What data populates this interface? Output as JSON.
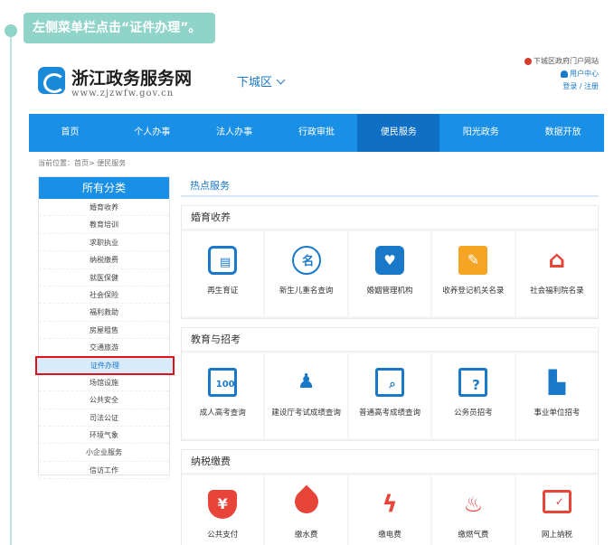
{
  "instruction": "左侧菜单栏点击“证件办理”。",
  "site": {
    "title": "浙江政务服务网",
    "url": "www.zjzwfw.gov.cn",
    "region": "下城区",
    "portal_link": "下城区政府门户网站",
    "user_center": "用户中心",
    "login": "登录",
    "register": "注册"
  },
  "nav": [
    "首页",
    "个人办事",
    "法人办事",
    "行政审批",
    "便民服务",
    "阳光政务",
    "数据开放"
  ],
  "nav_active_index": 4,
  "breadcrumb": "当前位置：首页> 便民服务",
  "sidebar": {
    "title": "所有分类",
    "items": [
      "婚育收养",
      "教育培训",
      "求职执业",
      "纳税缴费",
      "就医保健",
      "社会保险",
      "福利救助",
      "房屋租售",
      "交通旅游",
      "证件办理",
      "场馆设施",
      "公共安全",
      "司法公证",
      "环境气象",
      "小企业服务",
      "信访工作"
    ],
    "selected_index": 9
  },
  "hot_title": "热点服务",
  "sections": [
    {
      "title": "婚育收养",
      "tiles": [
        {
          "label": "再生育证",
          "icon": "id-card-icon"
        },
        {
          "label": "新生儿重名查询",
          "icon": "name-search-icon"
        },
        {
          "label": "婚姻管理机构",
          "icon": "couple-icon"
        },
        {
          "label": "收养登记机关名录",
          "icon": "document-pen-icon"
        },
        {
          "label": "社会福利院名录",
          "icon": "house-heart-icon"
        }
      ]
    },
    {
      "title": "教育与招考",
      "tiles": [
        {
          "label": "成人高考查询",
          "icon": "score-100-icon"
        },
        {
          "label": "建设厅考试成绩查询",
          "icon": "person-pen-icon"
        },
        {
          "label": "普通高考成绩查询",
          "icon": "search-document-icon"
        },
        {
          "label": "公务员招考",
          "icon": "question-pen-icon"
        },
        {
          "label": "事业单位招考",
          "icon": "building-icon"
        }
      ]
    },
    {
      "title": "纳税缴费",
      "tiles": [
        {
          "label": "公共支付",
          "icon": "yuan-shield-icon"
        },
        {
          "label": "缴水费",
          "icon": "water-drop-icon"
        },
        {
          "label": "缴电费",
          "icon": "lightning-icon"
        },
        {
          "label": "缴燃气费",
          "icon": "flame-icon"
        },
        {
          "label": "网上纳税",
          "icon": "monitor-icon"
        }
      ]
    }
  ],
  "colors": {
    "primary": "#1a8fe6",
    "active_nav": "#0f6fc4",
    "highlight_border": "#e0101a",
    "instruction_bg": "#8fd3c9",
    "accent_orange": "#f4a523",
    "accent_red": "#e8453a"
  }
}
